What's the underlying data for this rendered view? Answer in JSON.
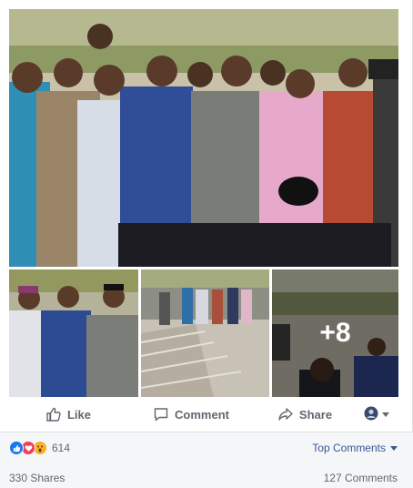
{
  "photos": {
    "more_count": "+8"
  },
  "actions": {
    "like_label": "Like",
    "comment_label": "Comment",
    "share_label": "Share"
  },
  "reactions": {
    "count": "614",
    "types": [
      "like",
      "love",
      "wow"
    ]
  },
  "sorting": {
    "label": "Top Comments"
  },
  "stats": {
    "shares": "330 Shares",
    "comments": "127 Comments"
  },
  "colors": {
    "link": "#365899",
    "muted": "#606770",
    "like_blue": "#1877f2",
    "love_red": "#f33e58",
    "wow_yellow": "#f7b125"
  }
}
